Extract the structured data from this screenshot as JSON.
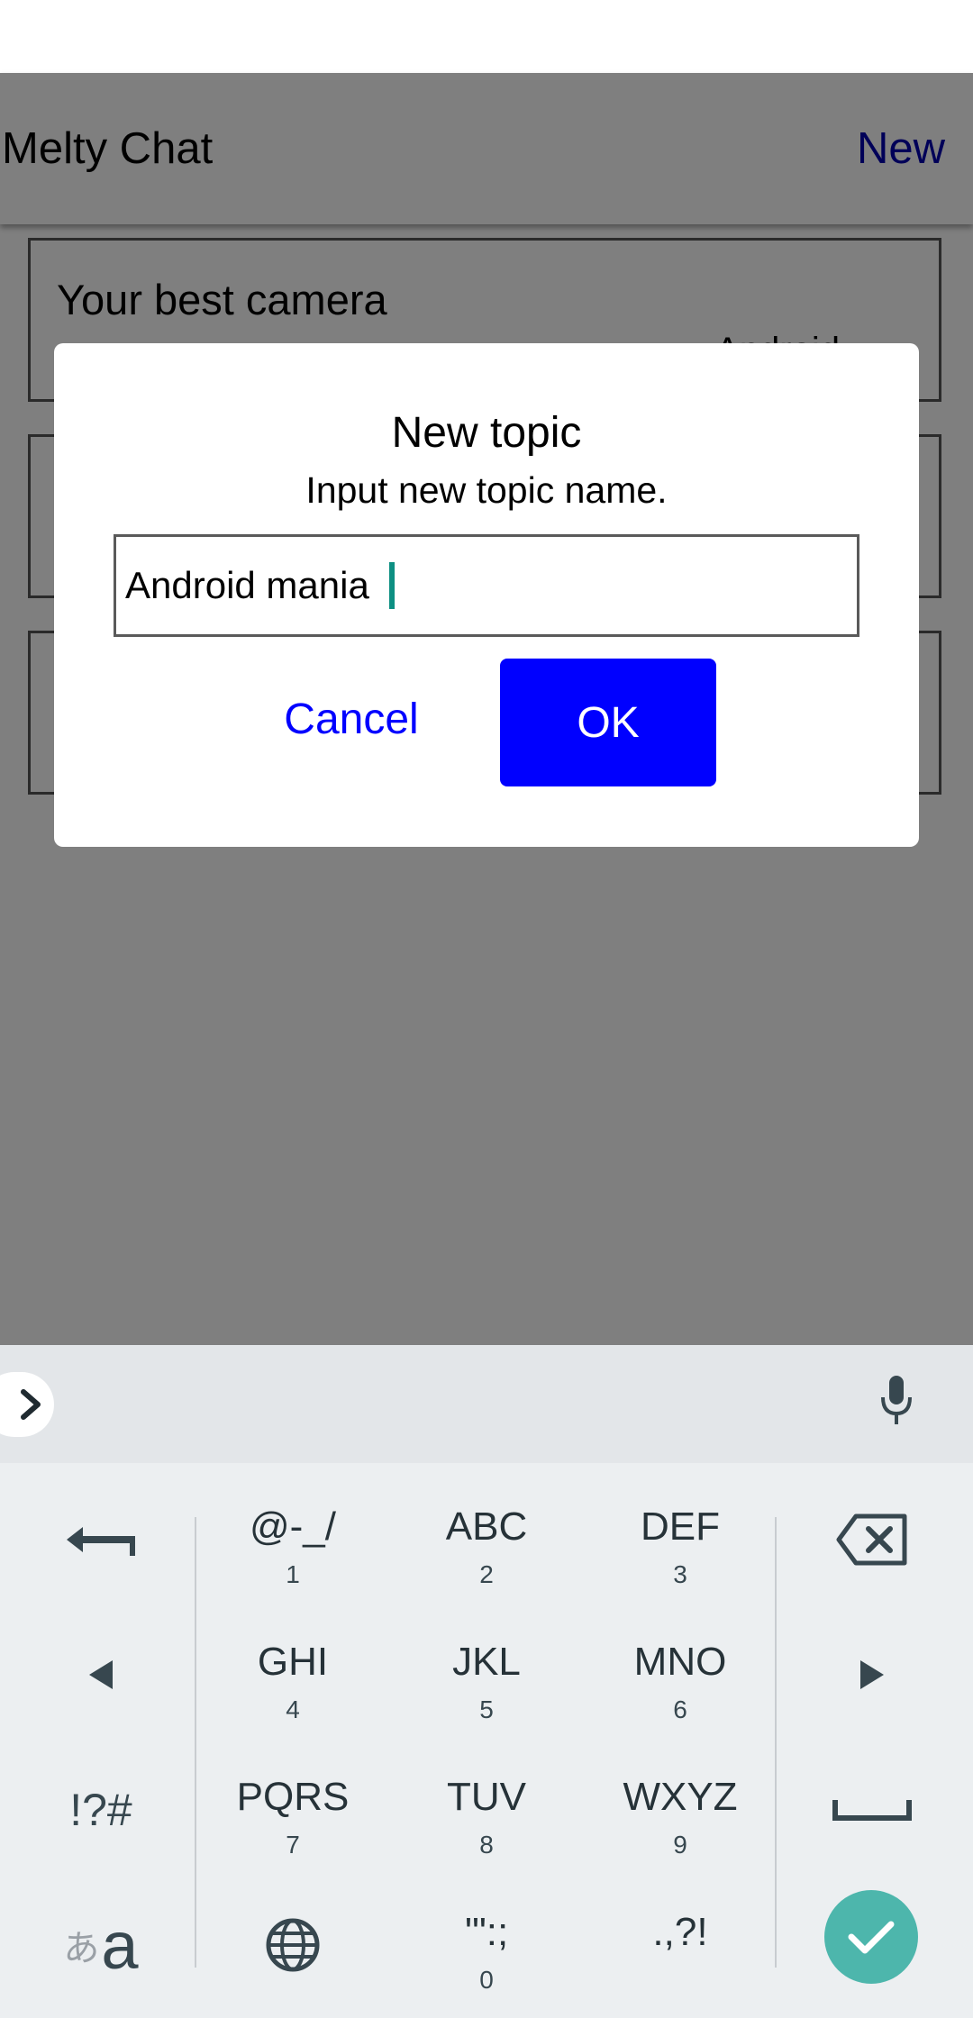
{
  "app": {
    "title": "Melty Chat",
    "new_label": "New",
    "topics": [
      {
        "title": "Your best camera",
        "author": "Android"
      },
      {
        "title": "",
        "author": ""
      },
      {
        "title": "",
        "author": ""
      }
    ]
  },
  "dialog": {
    "title": "New topic",
    "message": "Input new topic name.",
    "input_value": "Android mania ",
    "cancel_label": "Cancel",
    "ok_label": "OK"
  },
  "keyboard": {
    "rows": [
      [
        {
          "main": "@-_/",
          "sub": "1"
        },
        {
          "main": "ABC",
          "sub": "2"
        },
        {
          "main": "DEF",
          "sub": "3"
        }
      ],
      [
        {
          "main": "GHI",
          "sub": "4"
        },
        {
          "main": "JKL",
          "sub": "5"
        },
        {
          "main": "MNO",
          "sub": "6"
        }
      ],
      [
        {
          "main": "PQRS",
          "sub": "7"
        },
        {
          "main": "TUV",
          "sub": "8"
        },
        {
          "main": "WXYZ",
          "sub": "9"
        }
      ],
      [
        {
          "main": "",
          "sub": ""
        },
        {
          "main": "'\":;",
          "sub": "0"
        },
        {
          "main": ".,?!",
          "sub": ""
        }
      ]
    ],
    "symbols_label": "!?#",
    "kana_label": "あ",
    "latin_label": "a"
  },
  "colors": {
    "accent_blue": "#0000ff",
    "link_blue": "#0000b0",
    "caret_teal": "#0d8f82",
    "enter_teal": "#4db6ac"
  }
}
